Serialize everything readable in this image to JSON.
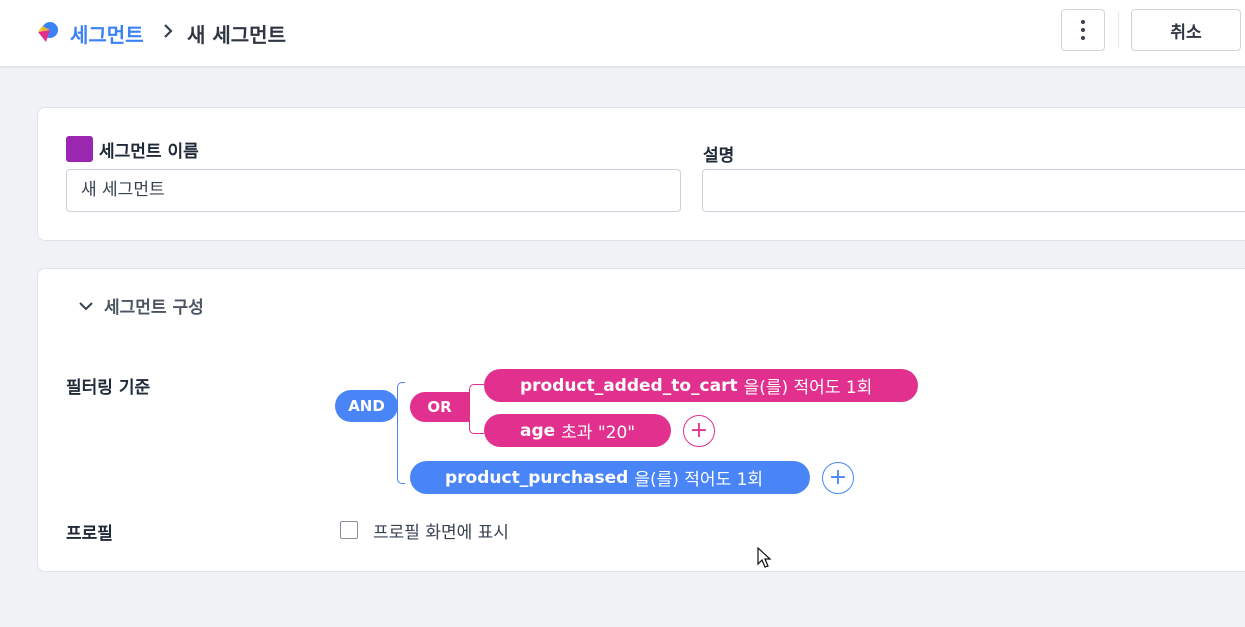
{
  "header": {
    "breadcrumb_root": "세그먼트",
    "breadcrumb_current": "새 세그먼트",
    "cancel_label": "취소",
    "icons": {
      "logo": "app-logo-icon",
      "separator": "chevron-right-icon",
      "more": "more-vertical-icon"
    }
  },
  "segment_info": {
    "name_label": "세그먼트 이름",
    "name_value": "새 세그먼트",
    "color": "#9b27b0",
    "description_label": "설명",
    "description_value": ""
  },
  "composition": {
    "section_title": "세그먼트 구성",
    "filter_label": "필터링 기준",
    "and_label": "AND",
    "or_label": "OR",
    "conditions": [
      {
        "event": "product_added_to_cart",
        "rule": "을(를) 적어도 1회"
      },
      {
        "event": "age",
        "rule": "초과 \"20\""
      },
      {
        "event": "product_purchased",
        "rule": "을(를) 적어도 1회"
      }
    ],
    "add_symbol": "+",
    "profile_label": "프로필",
    "profile_checkbox_label": "프로필 화면에 표시",
    "profile_checked": false
  },
  "colors": {
    "accent_blue": "#4a85f7",
    "accent_pink": "#e2308f",
    "breadcrumb_blue": "#3b82f6"
  }
}
